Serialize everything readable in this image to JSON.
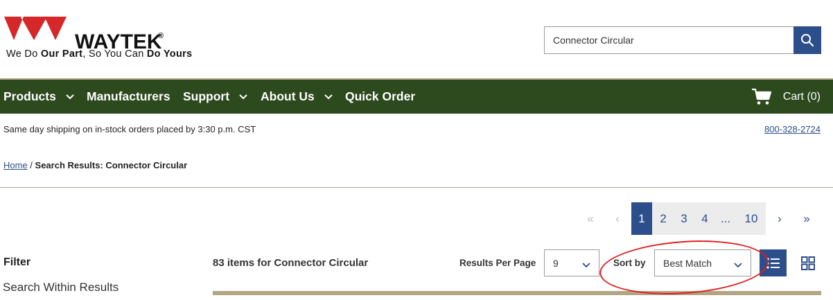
{
  "header": {
    "brand": "WAYTEK",
    "registered": "®",
    "tagline": {
      "t1": "We Do ",
      "b1": "Our Part",
      "t2": ", So You Can ",
      "b2": "Do Yours"
    },
    "search": {
      "value": "Connector Circular",
      "button_icon": "search-icon"
    }
  },
  "nav": {
    "items": [
      {
        "label": "Products",
        "has_dropdown": true
      },
      {
        "label": "Manufacturers",
        "has_dropdown": false
      },
      {
        "label": "Support",
        "has_dropdown": true
      },
      {
        "label": "About Us",
        "has_dropdown": true
      },
      {
        "label": "Quick Order",
        "has_dropdown": false
      }
    ],
    "cart_label": "Cart (0)",
    "cart_icon": "cart-icon"
  },
  "info": {
    "shipping": "Same day shipping on in-stock orders placed by 3:30 p.m. CST",
    "phone": "800-328-2724"
  },
  "breadcrumb": {
    "home": "Home",
    "separator": " / ",
    "current": "Search Results: Connector Circular"
  },
  "pagination": {
    "first_icon": "«",
    "prev_icon": "‹",
    "pages": [
      "1",
      "2",
      "3",
      "4",
      "...",
      "10"
    ],
    "current_page": "1",
    "next_icon": "›",
    "last_icon": "»"
  },
  "filter": {
    "title": "Filter",
    "search_within": "Search Within Results"
  },
  "results": {
    "count_text": "83 items for Connector Circular",
    "per_page_label": "Results Per Page",
    "per_page_value": "9",
    "sort_label": "Sort by",
    "sort_value": "Best Match"
  },
  "colors": {
    "brand_red": "#d6282a",
    "nav_green": "#2d4a1f",
    "accent_blue": "#2c4e8a",
    "rule_tan": "#b2a585",
    "annotation_red": "#e11d1d"
  }
}
